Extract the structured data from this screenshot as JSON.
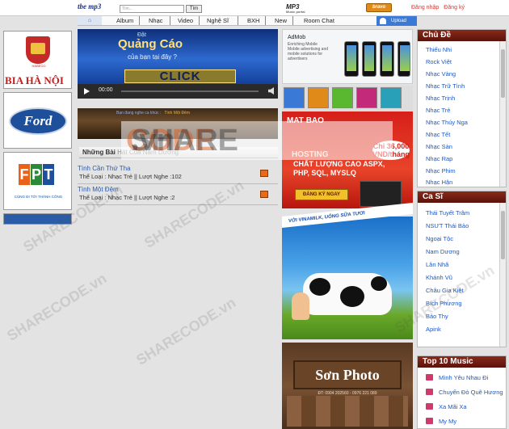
{
  "topbar": {
    "logo": "tbe mp3",
    "search_placeholder": "Tìm...",
    "search_button": "Tìm",
    "mp3_badge": "MP3",
    "mp3_badge_sub": "Music portal",
    "bravo_badge": "bravo",
    "register": "Đăng nhập",
    "login": "Đăng ký"
  },
  "menu": {
    "home": "⌂",
    "items": [
      "Album",
      "Nhạc",
      "Video",
      "Nghệ Sĩ",
      "BXH",
      "New",
      "Room Chat"
    ],
    "upload": "Upload"
  },
  "left_ads": {
    "bia_label": "HABECO",
    "bia_text": "BIA HÀ NỘI",
    "ford_text": "Ford",
    "fpt_letters": [
      "F",
      "P",
      "T"
    ],
    "fpt_sub": "CÙNG ĐI TỚI THÀNH CÔNG"
  },
  "center": {
    "banner": {
      "line1": "Đặt",
      "line2": "Quảng Cáo",
      "line3": "của bạn tại đây ?",
      "click": "CLICK"
    },
    "player": {
      "time": "00:00"
    },
    "now_playing_label": "Bạn đang nghe ca khúc :",
    "now_playing_song": "Tình Một Đêm",
    "songs_header": "Những Bài",
    "songs_header_rest": "Hát Của Nam Dương",
    "songs": [
      {
        "title": "Tình Cần Thứ Tha",
        "meta": "Thể Loại : Nhạc Trẻ  || Lượt Nghe :102"
      },
      {
        "title": "Tình Một Đêm",
        "meta": "Thể Loại : Nhạc Trẻ  || Lượt Nghe :2"
      }
    ]
  },
  "mid_ads": {
    "admob_title": "AdMob",
    "admob_sub": "Enriching Mobile",
    "admob_desc": "Mobile advertising and mobile solutions for advertisers",
    "matbao_brand": "MAT BAO",
    "matbao_host": "HOSTING",
    "matbao_features": "CHẤT LƯỢNG CAO ASPX, PHP, SQL, MYSLQ",
    "matbao_price": "Chỉ 36,000 VND/tháng",
    "matbao_register": "ĐĂNG KÝ NGAY",
    "vinamilk_head": "VỚI VINAMILK, UỐNG SỮA TƯƠI",
    "sonphoto_title": "Sơn Photo",
    "sonphoto_small": "ĐT: 0904 202560 - 0976 221 089"
  },
  "sidebar": {
    "chude_title": "Chủ Đề",
    "chude_items": [
      "Thiếu Nhi",
      "Rock Việt",
      "Nhạc Vàng",
      "Nhạc Trữ Tình",
      "Nhạc Trịnh",
      "Nhạc Trẻ",
      "Nhạc Thúy Nga",
      "Nhạc Tết",
      "Nhạc Sàn",
      "Nhạc Rap",
      "Nhạc Phim",
      "Nhạc Hận"
    ],
    "casi_title": "Ca Sĩ",
    "casi_items": [
      "Thái Tuyết Trâm",
      "NSƯT Thái Bảo",
      "Ngoại Tộc",
      "Nam Dương",
      "Lân Nhã",
      "Khánh Vũ",
      "Châu Gia Kiệt",
      "Bích Phương",
      "Bảo Thy",
      "Apink"
    ],
    "top10_title": "Top 10 Music",
    "top10_items": [
      "Mình Yêu Nhau Đi",
      "Chuyến Đò Quê Hương",
      "Xa Mãi Xa",
      "My My"
    ]
  },
  "watermark": {
    "brand1": "SHARE",
    "brand2": "CODE",
    "domain": ".vn",
    "center1": "SHARE",
    "center2": "CODE",
    "center3": ".vn"
  },
  "colors": {
    "accent": "#1a58c8",
    "sidebar_header": "#6a1a10",
    "upload": "#3a7ad6"
  }
}
